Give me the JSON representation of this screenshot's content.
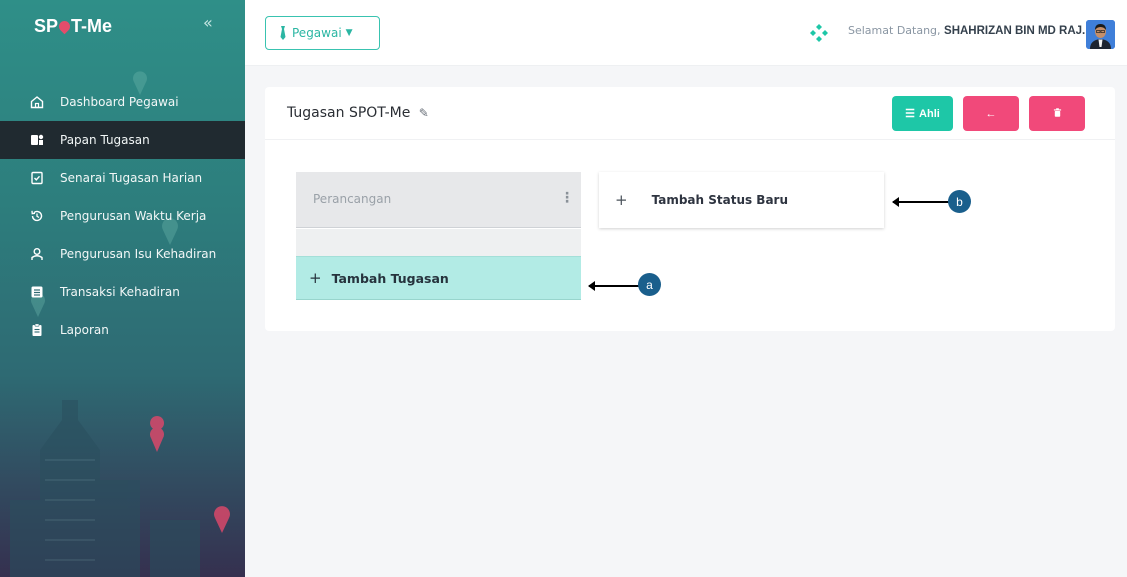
{
  "sidebar": {
    "brand": "SPOT-Me",
    "brand_prefix": "SP",
    "brand_suffix": "T-Me",
    "collapse_icon": "«",
    "items": [
      {
        "label": "Dashboard Pegawai",
        "icon": "home-icon",
        "active": false
      },
      {
        "label": "Papan Tugasan",
        "icon": "board-icon",
        "active": true
      },
      {
        "label": "Senarai Tugasan Harian",
        "icon": "checklist-icon",
        "active": false
      },
      {
        "label": "Pengurusan Waktu Kerja",
        "icon": "history-icon",
        "active": false
      },
      {
        "label": "Pengurusan Isu Kehadiran",
        "icon": "user-icon",
        "active": false
      },
      {
        "label": "Transaksi Kehadiran",
        "icon": "list-icon",
        "active": false
      },
      {
        "label": "Laporan",
        "icon": "report-icon",
        "active": false
      }
    ]
  },
  "topbar": {
    "role_label": "Pegawai",
    "welcome_label": "Selamat Datang,",
    "user_name": "SHAHRIZAN BIN MD RAJ..."
  },
  "card": {
    "title": "Tugasan SPOT-Me",
    "buttons": {
      "ahli": "Ahli",
      "back": "←",
      "delete": "🗑"
    }
  },
  "board": {
    "column_title": "Perancangan",
    "add_task_label": "Tambah Tugasan",
    "add_status_label": "Tambah Status Baru"
  },
  "annotations": {
    "a": "a",
    "b": "b"
  },
  "colors": {
    "accent": "#1ec7a7",
    "danger": "#f1497a",
    "sidebar_active": "#202a30",
    "marker": "#1a5f8c"
  }
}
